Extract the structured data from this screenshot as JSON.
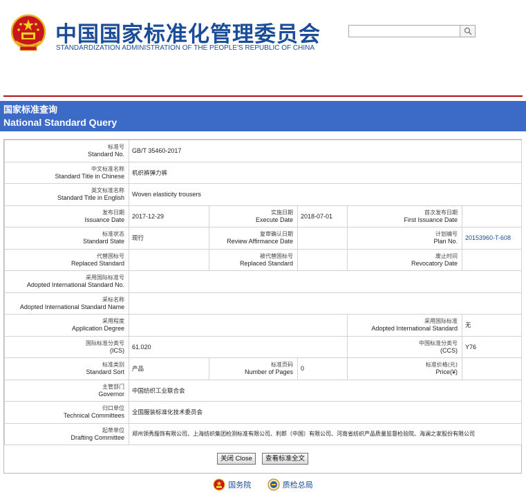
{
  "header": {
    "title_cn": "中国国家标准化管理委员会",
    "title_en": "STANDARDIZATION ADMINISTRATION OF THE PEOPLE'S REPUBLIC OF CHINA",
    "search_value": ""
  },
  "banner": {
    "title_cn": "国家标准查询",
    "title_en": "National Standard Query"
  },
  "fields": {
    "standard_no": {
      "cn": "标准号",
      "en": "Standard No.",
      "value": "GB/T 35460-2017"
    },
    "title_chinese": {
      "cn": "中文标准名称",
      "en": "Standard Title in Chinese",
      "value": "机织裤弹力裤"
    },
    "title_english": {
      "cn": "英文标准名称",
      "en": "Standard Title in English",
      "value": "Woven elasticity trousers"
    },
    "issuance_date": {
      "cn": "发布日期",
      "en": "Issuance Date",
      "value": "2017-12-29"
    },
    "execute_date": {
      "cn": "实施日期",
      "en": "Execute Date",
      "value": "2018-07-01"
    },
    "first_issuance_date": {
      "cn": "首次发布日期",
      "en": "First Issuance Date",
      "value": ""
    },
    "standard_state": {
      "cn": "标准状态",
      "en": "Standard State",
      "value": "现行"
    },
    "review_affirmance_date": {
      "cn": "复审确认日期",
      "en": "Review Affirmance Date",
      "value": ""
    },
    "plan_no": {
      "cn": "计划编号",
      "en": "Plan No.",
      "value": "20153960-T-608"
    },
    "replaced_standard": {
      "cn": "代替国标号",
      "en": "Replaced Standard",
      "value": ""
    },
    "replaced_by": {
      "cn": "被代替国标号",
      "en": "Replaced Standard",
      "value": ""
    },
    "revocatory_date": {
      "cn": "废止时间",
      "en": "Revocatory Date",
      "value": ""
    },
    "adopted_intl_no": {
      "cn": "采用国际标准号",
      "en": "Adopted International Standard No.",
      "value": ""
    },
    "adopted_intl_name": {
      "cn": "采标名称",
      "en": "Adopted International Standard Name",
      "value": ""
    },
    "application_degree": {
      "cn": "采用程度",
      "en": "Application Degree",
      "value": ""
    },
    "adopted_intl_standard": {
      "cn": "采用国际标准",
      "en": "Adopted International Standard",
      "value": "无"
    },
    "ics": {
      "cn": "国际标准分类号",
      "en": "(ICS)",
      "value": "61.020"
    },
    "ccs": {
      "cn": "中国标准分类号",
      "en": "(CCS)",
      "value": "Y76"
    },
    "standard_sort": {
      "cn": "标准类别",
      "en": "Standard Sort",
      "value": "产品"
    },
    "number_of_pages": {
      "cn": "标准页码",
      "en": "Number of Pages",
      "value": "0"
    },
    "price": {
      "cn": "标准价格(元)",
      "en": "Price(¥)",
      "value": ""
    },
    "governor": {
      "cn": "主管部门",
      "en": "Governor",
      "value": "中国纺织工业联合会"
    },
    "technical_committees": {
      "cn": "归口单位",
      "en": "Technical Committees",
      "value": "全国服装标准化技术委员会"
    },
    "drafting_committee": {
      "cn": "起草单位",
      "en": "Drafting Committee",
      "value": "郑州领秀服饰有限公司、上海纺织集团检测标准有限公司、利郎（中国）有限公司、河南省纺织产品质量监督检验院、海澜之家股份有限公司"
    }
  },
  "buttons": {
    "close": "关闭 Close",
    "view_full": "查看标准全文"
  },
  "footer": {
    "link1": "国务院",
    "link2": "质检总局"
  },
  "colors": {
    "brand_blue": "#1a4c98",
    "banner_blue": "#3b6bc6",
    "rule_red": "#b70f12"
  }
}
